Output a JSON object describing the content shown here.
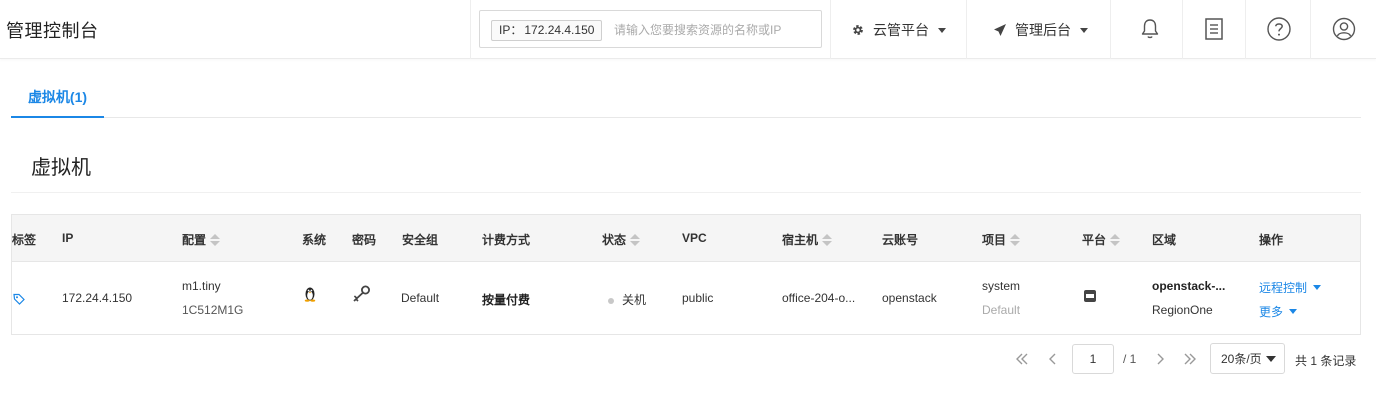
{
  "header": {
    "brand": "管理控制台",
    "search": {
      "tag_key": "IP：",
      "tag_value": "172.24.4.150",
      "placeholder": "请输入您要搜索资源的名称或IP"
    },
    "menus": [
      {
        "label": "云管平台",
        "icon": "gear-icon"
      },
      {
        "label": "管理后台",
        "icon": "rocket-icon"
      }
    ],
    "icons": [
      "bell-icon",
      "document-icon",
      "help-icon",
      "user-icon"
    ]
  },
  "tabs": [
    {
      "label": "虚拟机(1)",
      "active": true
    }
  ],
  "section": {
    "title": "虚拟机"
  },
  "table": {
    "columns": [
      {
        "label": "标签",
        "sortable": false
      },
      {
        "label": "IP",
        "sortable": false
      },
      {
        "label": "配置",
        "sortable": true
      },
      {
        "label": "系统",
        "sortable": false
      },
      {
        "label": "密码",
        "sortable": false
      },
      {
        "label": "安全组",
        "sortable": false
      },
      {
        "label": "计费方式",
        "sortable": false
      },
      {
        "label": "状态",
        "sortable": true
      },
      {
        "label": "VPC",
        "sortable": false
      },
      {
        "label": "宿主机",
        "sortable": true
      },
      {
        "label": "云账号",
        "sortable": false
      },
      {
        "label": "项目",
        "sortable": true
      },
      {
        "label": "平台",
        "sortable": true
      },
      {
        "label": "区域",
        "sortable": false
      },
      {
        "label": "操作",
        "sortable": false
      }
    ],
    "rows": [
      {
        "tag_icon": "tag-icon",
        "ip": "172.24.4.150",
        "config_name": "m1.tiny",
        "config_spec": "1C512M1G",
        "os_icon": "linux-penguin-icon",
        "password_icon": "key-icon",
        "security_group": "Default",
        "billing": "按量付费",
        "status": "关机",
        "vpc": "public",
        "host": "office-204-o...",
        "cloud_account": "openstack",
        "project": "system",
        "project_domain": "Default",
        "platform_icon": "openstack-icon",
        "region_name": "openstack-...",
        "region_sub": "RegionOne",
        "action_remote": "远程控制",
        "action_more": "更多"
      }
    ]
  },
  "pagination": {
    "current_page": "1",
    "total_pages": "/ 1",
    "page_size": "20条/页",
    "total_records": "共 1 条记录"
  },
  "colors": {
    "accent": "#1b87e6",
    "status_off": "#c8c8c8"
  }
}
